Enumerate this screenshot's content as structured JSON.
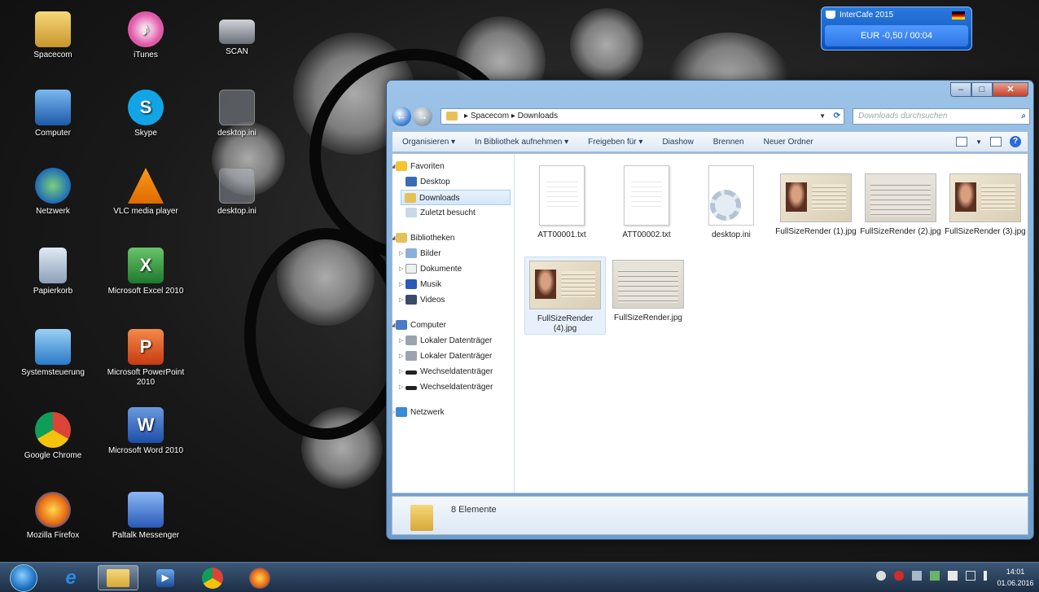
{
  "desktop": {
    "icons": [
      {
        "label": "Spacecom"
      },
      {
        "label": "iTunes"
      },
      {
        "label": "SCAN"
      },
      {
        "label": "Computer"
      },
      {
        "label": "Skype"
      },
      {
        "label": "desktop.ini"
      },
      {
        "label": "Netzwerk"
      },
      {
        "label": "VLC media player"
      },
      {
        "label": "desktop.ini"
      },
      {
        "label": "Papierkorb"
      },
      {
        "label": "Microsoft Excel 2010"
      },
      {
        "label": "Systemsteuerung"
      },
      {
        "label": "Microsoft PowerPoint 2010"
      },
      {
        "label": "Google Chrome"
      },
      {
        "label": "Microsoft Word 2010"
      },
      {
        "label": "Mozilla Firefox"
      },
      {
        "label": "Paltalk Messenger"
      }
    ]
  },
  "intercafe": {
    "title": "InterCafe 2015",
    "balance": "EUR -0,50 / 00:04"
  },
  "explorer": {
    "breadcrumb": [
      "Spacecom",
      "Downloads"
    ],
    "search_placeholder": "Downloads durchsuchen",
    "toolbar": {
      "organize": "Organisieren ▾",
      "library": "In Bibliothek aufnehmen ▾",
      "share": "Freigeben für ▾",
      "slideshow": "Diashow",
      "burn": "Brennen",
      "new_folder": "Neuer Ordner"
    },
    "nav": {
      "favorites": "Favoriten",
      "desktop": "Desktop",
      "downloads": "Downloads",
      "recent": "Zuletzt besucht",
      "libraries": "Bibliotheken",
      "pictures": "Bilder",
      "documents": "Dokumente",
      "music": "Musik",
      "videos": "Videos",
      "computer": "Computer",
      "local1": "Lokaler Datenträger",
      "local2": "Lokaler Datenträger",
      "removable1": "Wechseldatenträger",
      "removable2": "Wechseldatenträger",
      "network": "Netzwerk"
    },
    "files": [
      {
        "name": "ATT00001.txt",
        "kind": "text"
      },
      {
        "name": "ATT00002.txt",
        "kind": "text"
      },
      {
        "name": "desktop.ini",
        "kind": "ini"
      },
      {
        "name": "FullSizeRender (1).jpg",
        "kind": "photo-front"
      },
      {
        "name": "FullSizeRender (2).jpg",
        "kind": "photo-back"
      },
      {
        "name": "FullSizeRender (3).jpg",
        "kind": "photo-front"
      },
      {
        "name": "FullSizeRender (4).jpg",
        "kind": "photo-front"
      },
      {
        "name": "FullSizeRender.jpg",
        "kind": "photo-back"
      }
    ],
    "status": "8 Elemente"
  },
  "taskbar": {
    "time": "14:01",
    "date": "01.06.2016"
  }
}
